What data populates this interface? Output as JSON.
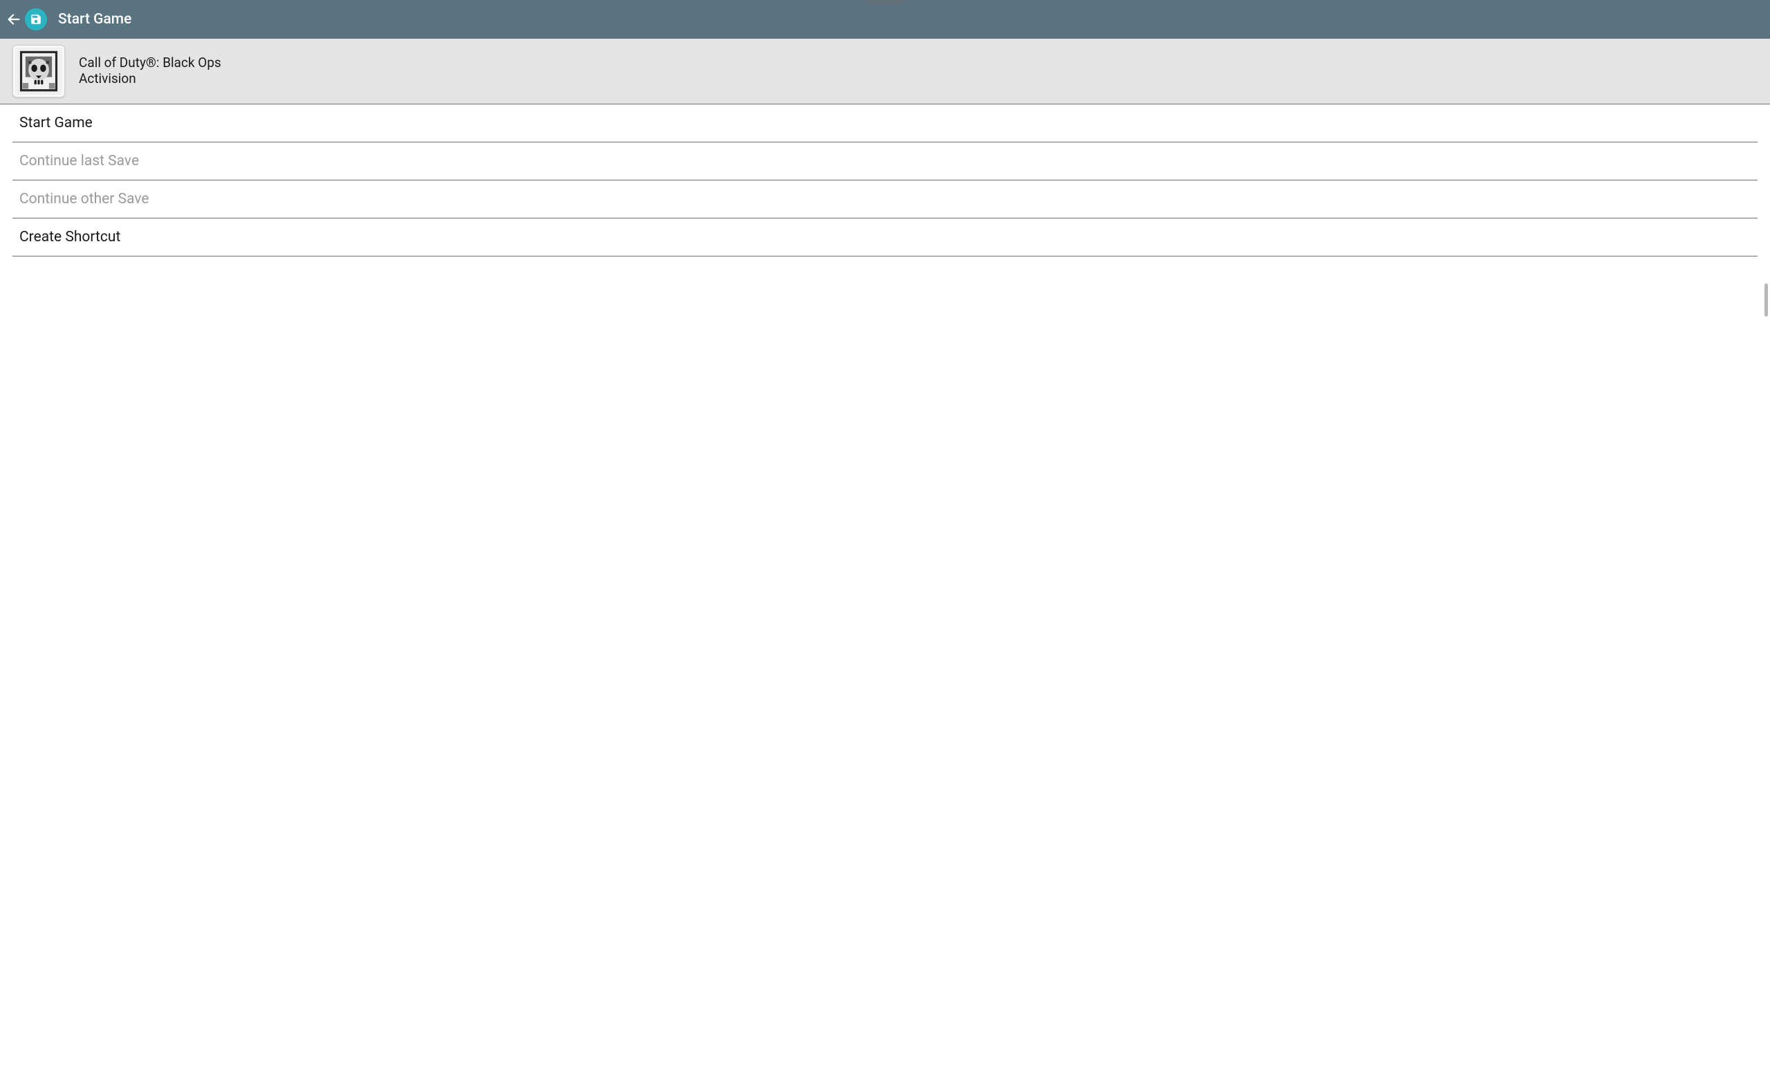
{
  "header": {
    "title": "Start Game"
  },
  "game": {
    "title": "Call of Duty®: Black Ops",
    "publisher": "Activision"
  },
  "menu": {
    "items": [
      {
        "label": "Start Game",
        "enabled": true
      },
      {
        "label": "Continue last Save",
        "enabled": false
      },
      {
        "label": "Continue other Save",
        "enabled": false
      },
      {
        "label": "Create Shortcut",
        "enabled": true
      }
    ]
  }
}
